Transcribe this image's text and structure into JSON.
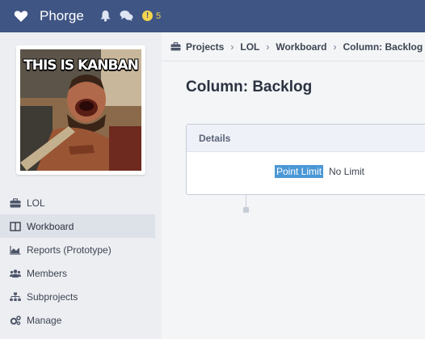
{
  "header": {
    "brand": "Phorge",
    "alert_count": "5",
    "alert_symbol": "!",
    "icons": [
      "heart-logo-icon",
      "bell-icon",
      "chat-icon",
      "alert-icon"
    ]
  },
  "project": {
    "image_text": "THIS IS KANBAN"
  },
  "sidebar": {
    "items": [
      {
        "label": "LOL",
        "icon": "briefcase-icon",
        "active": false
      },
      {
        "label": "Workboard",
        "icon": "columns-icon",
        "active": true
      },
      {
        "label": "Reports (Prototype)",
        "icon": "area-chart-icon",
        "active": false
      },
      {
        "label": "Members",
        "icon": "group-icon",
        "active": false
      },
      {
        "label": "Subprojects",
        "icon": "sitemap-icon",
        "active": false
      },
      {
        "label": "Manage",
        "icon": "gears-icon",
        "active": false
      }
    ]
  },
  "breadcrumbs": [
    "Projects",
    "LOL",
    "Workboard",
    "Column: Backlog"
  ],
  "page": {
    "title": "Column: Backlog"
  },
  "details": {
    "header": "Details",
    "property_label": "Point Limit",
    "property_value": "No Limit"
  },
  "colors": {
    "topbar": "#3f5584",
    "alert": "#f3d54d",
    "selection": "#4b98d6",
    "sidebar": "#eceef2"
  }
}
